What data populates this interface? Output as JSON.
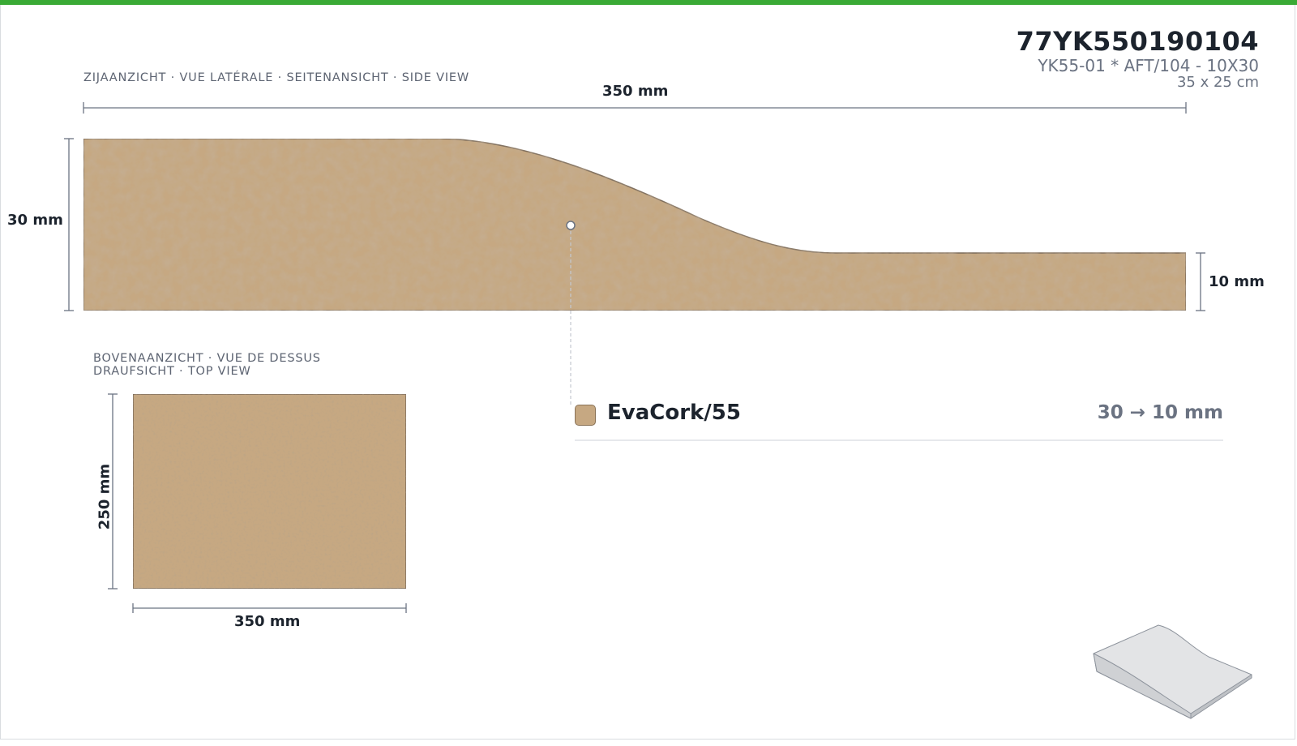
{
  "header": {
    "article_code": "77YK550190104",
    "description": "YK55-01 * AFT/104 - 10X30",
    "size": "35 x 25 cm"
  },
  "side_view": {
    "caption": "ZIJAANZICHT · VUE LATÉRALE · SEITENANSICHT · SIDE VIEW",
    "length_label": "350 mm",
    "max_height_label": "30 mm",
    "min_height_label": "10 mm"
  },
  "top_view": {
    "caption_line1": "BOVENAANZICHT · VUE DE DESSUS",
    "caption_line2": "DRAUFSICHT · TOP VIEW",
    "width_label": "350 mm",
    "depth_label": "250 mm"
  },
  "material": {
    "name": "EvaCork/55",
    "thickness": "30 → 10 mm",
    "color": "#c6a882"
  },
  "colors": {
    "accent": "#3aaa35",
    "cork": "#c6a882",
    "cork_dark": "#8a7358",
    "dimension_line": "#6b7382"
  }
}
